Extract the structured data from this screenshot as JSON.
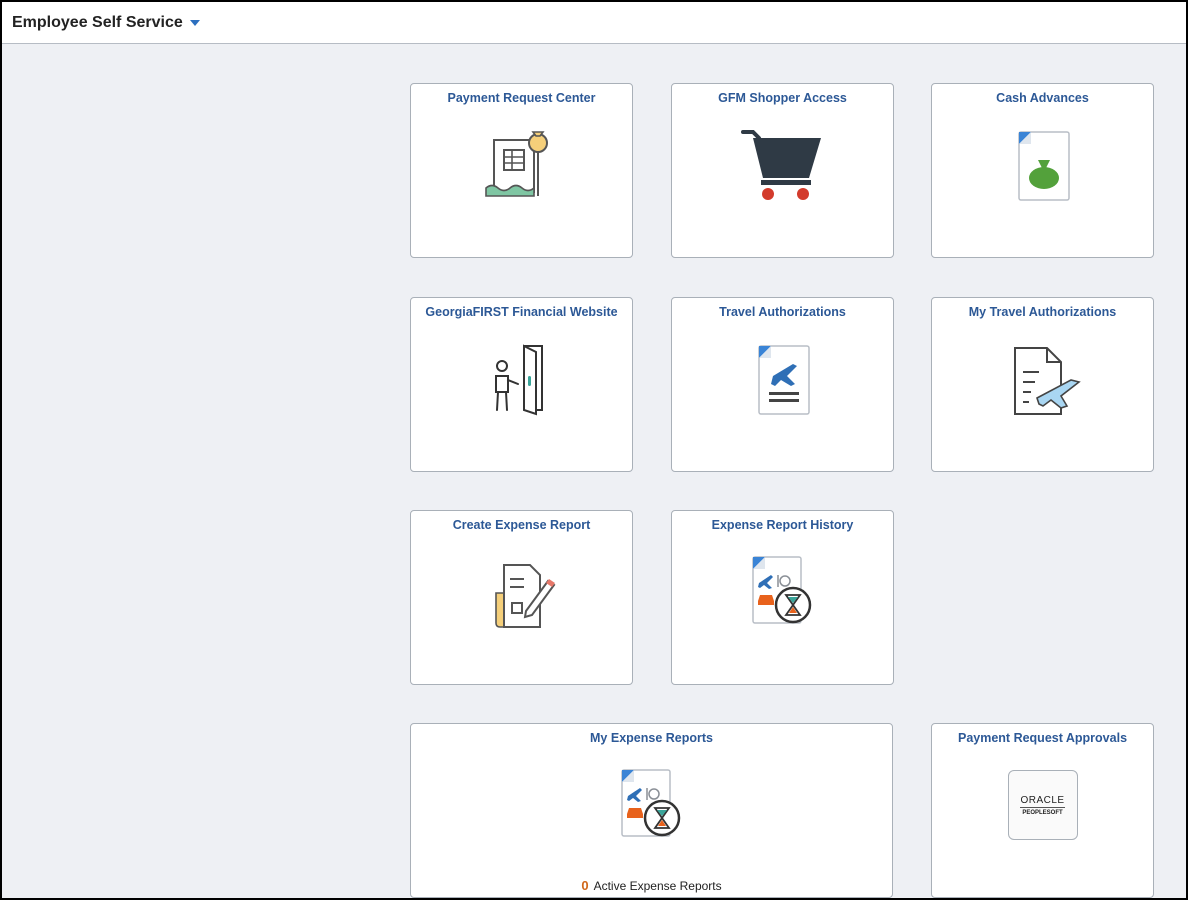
{
  "header": {
    "title": "Employee Self Service",
    "caret_icon": "caret-down-icon"
  },
  "colors": {
    "tile_title": "#2c5896",
    "count_accent": "#d0681b",
    "background": "#eef0f4"
  },
  "tiles": [
    {
      "id": "payment-request-center",
      "title": "Payment Request Center",
      "icon": "payment-document-icon"
    },
    {
      "id": "gfm-shopper-access",
      "title": "GFM Shopper Access",
      "icon": "shopping-cart-icon"
    },
    {
      "id": "cash-advances",
      "title": "Cash Advances",
      "icon": "money-bag-document-icon"
    },
    {
      "id": "georgiafirst-financial-website",
      "title": "GeorgiaFIRST Financial Website",
      "icon": "person-door-icon"
    },
    {
      "id": "travel-authorizations",
      "title": "Travel Authorizations",
      "icon": "plane-document-icon"
    },
    {
      "id": "my-travel-authorizations",
      "title": "My Travel Authorizations",
      "icon": "document-airplane-icon"
    },
    {
      "id": "create-expense-report",
      "title": "Create Expense Report",
      "icon": "document-pencil-icon"
    },
    {
      "id": "expense-report-history",
      "title": "Expense Report History",
      "icon": "expense-hourglass-icon"
    },
    {
      "id": "my-expense-reports",
      "title": "My Expense Reports",
      "icon": "expense-hourglass-icon",
      "count": "0",
      "count_label": "Active Expense Reports"
    },
    {
      "id": "payment-request-approvals",
      "title": "Payment Request Approvals",
      "icon": "oracle-peoplesoft-logo-icon",
      "logo_line1": "ORACLE",
      "logo_line2": "PEOPLESOFT"
    }
  ]
}
